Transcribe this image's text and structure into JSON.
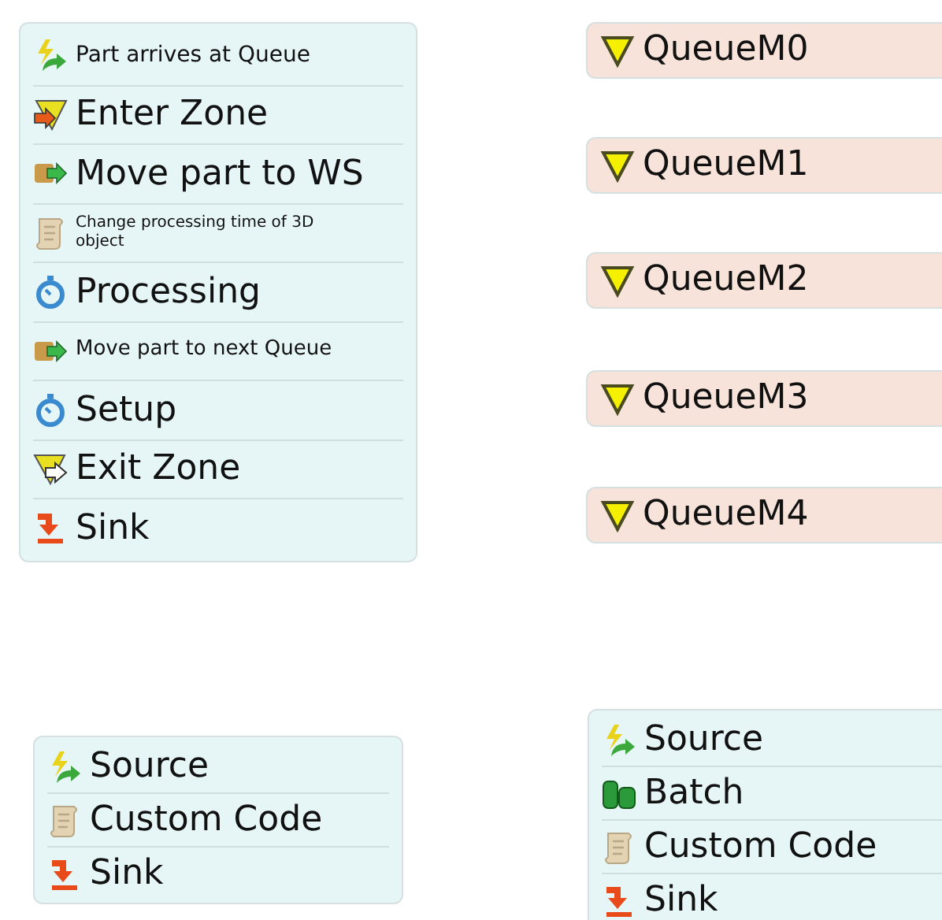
{
  "blocks": [
    {
      "kind": "list",
      "steps": [
        {
          "kind": "source",
          "label": "Part arrives at Queue"
        },
        {
          "kind": "enter",
          "label": "Enter Zone"
        },
        {
          "kind": "move",
          "label": "Move part to WS"
        },
        {
          "kind": "code",
          "label": "Change processing time of 3D object"
        },
        {
          "kind": "timer",
          "label": "Processing"
        },
        {
          "kind": "move",
          "label": "Move part to next Queue"
        },
        {
          "kind": "timer",
          "label": "Setup"
        },
        {
          "kind": "exit",
          "label": "Exit Zone"
        },
        {
          "kind": "sink",
          "label": "Sink"
        }
      ]
    },
    {
      "kind": "queue",
      "steps": [
        {
          "kind": "queue",
          "label": "QueueM0"
        }
      ]
    },
    {
      "kind": "queue",
      "steps": [
        {
          "kind": "queue",
          "label": "QueueM1"
        }
      ]
    },
    {
      "kind": "queue",
      "steps": [
        {
          "kind": "queue",
          "label": "QueueM2"
        }
      ]
    },
    {
      "kind": "queue",
      "steps": [
        {
          "kind": "queue",
          "label": "QueueM3"
        }
      ]
    },
    {
      "kind": "queue",
      "steps": [
        {
          "kind": "queue",
          "label": "QueueM4"
        }
      ]
    },
    {
      "kind": "list",
      "steps": [
        {
          "kind": "source",
          "label": "Source"
        },
        {
          "kind": "code",
          "label": "Custom Code"
        },
        {
          "kind": "sink",
          "label": "Sink"
        }
      ]
    },
    {
      "kind": "list",
      "steps": [
        {
          "kind": "source",
          "label": "Source"
        },
        {
          "kind": "batch",
          "label": "Batch"
        },
        {
          "kind": "code",
          "label": "Custom Code"
        },
        {
          "kind": "sink",
          "label": "Sink"
        }
      ]
    }
  ]
}
